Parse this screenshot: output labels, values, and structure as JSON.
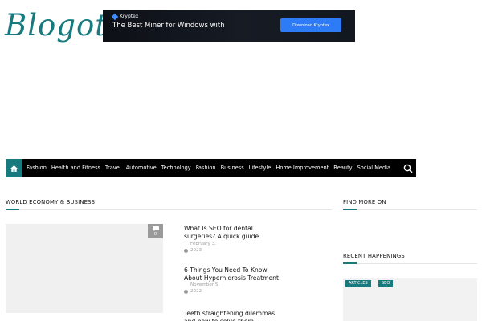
{
  "site": {
    "logo_text": "Blogot",
    "brand_color": "#177a7f"
  },
  "ad": {
    "brand": "Kryptex",
    "headline": "The Best Miner for Windows with",
    "cta": "Download Kryptex"
  },
  "nav": {
    "home_icon": "home-icon",
    "search_icon": "search-icon",
    "items": [
      {
        "label": "Fashion"
      },
      {
        "label": "Health and Fitness"
      },
      {
        "label": "Travel"
      },
      {
        "label": "Automotive"
      },
      {
        "label": "Technology"
      },
      {
        "label": "Fashion"
      },
      {
        "label": "Business"
      },
      {
        "label": "Lifestyle"
      },
      {
        "label": "Home Improvement"
      },
      {
        "label": "Beauty"
      },
      {
        "label": "Social Media"
      }
    ]
  },
  "main": {
    "section_title": "WORLD ECONOMY & BUSINESS",
    "feature": {
      "comment_icon": "comment-icon",
      "comment_count": "0"
    },
    "posts": [
      {
        "title": "What Is SEO for dental surgeries? A quick guide",
        "date": "February 3, 2023"
      },
      {
        "title": "6 Things You Need To Know About Hyperhidrosis Treatment",
        "date": "November 5, 2022"
      },
      {
        "title": "Teeth straightening dilemmas and how to solve them",
        "date": ""
      }
    ]
  },
  "sidebar": {
    "find_more_title": "FIND MORE ON",
    "recent_title": "RECENT HAPPENINGS",
    "recent_tags": [
      "ARTICLES",
      "SEO"
    ]
  }
}
